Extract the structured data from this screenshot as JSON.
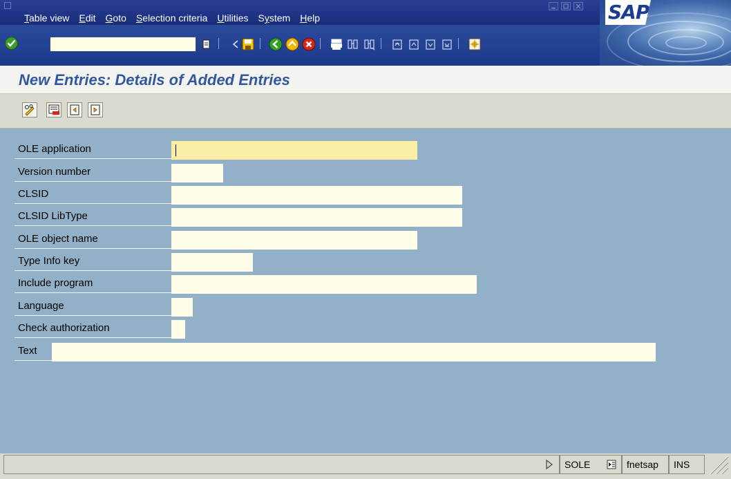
{
  "menubar": {
    "items": [
      {
        "prefix": "",
        "ul": "T",
        "rest": "able view"
      },
      {
        "prefix": "",
        "ul": "E",
        "rest": "dit"
      },
      {
        "prefix": "",
        "ul": "G",
        "rest": "oto"
      },
      {
        "prefix": "",
        "ul": "S",
        "rest": "election criteria"
      },
      {
        "prefix": "",
        "ul": "U",
        "rest": "tilities"
      },
      {
        "prefix": "S",
        "ul": "y",
        "rest": "stem"
      },
      {
        "prefix": "",
        "ul": "H",
        "rest": "elp"
      }
    ],
    "logo": "SAP"
  },
  "toolbar": {
    "command_value": ""
  },
  "page": {
    "title": "New Entries: Details of Added Entries"
  },
  "form": {
    "fields": [
      {
        "label": "OLE application",
        "value": "",
        "required": true
      },
      {
        "label": "Version number",
        "value": ""
      },
      {
        "label": "CLSID",
        "value": ""
      },
      {
        "label": "CLSID LibType",
        "value": ""
      },
      {
        "label": "OLE object name",
        "value": ""
      },
      {
        "label": "Type Info key",
        "value": ""
      },
      {
        "label": "Include program",
        "value": ""
      },
      {
        "label": "Language",
        "value": ""
      },
      {
        "label": "Check authorization",
        "value": ""
      },
      {
        "label": "Text",
        "value": ""
      }
    ]
  },
  "status": {
    "system": "SOLE",
    "server": "fnetsap",
    "mode": "INS"
  },
  "colors": {
    "menubar": "#1f3386",
    "form_background": "#92b0c7",
    "title_text": "#31589f",
    "required_field": "#fdeea5",
    "input_field": "#fffde8"
  }
}
